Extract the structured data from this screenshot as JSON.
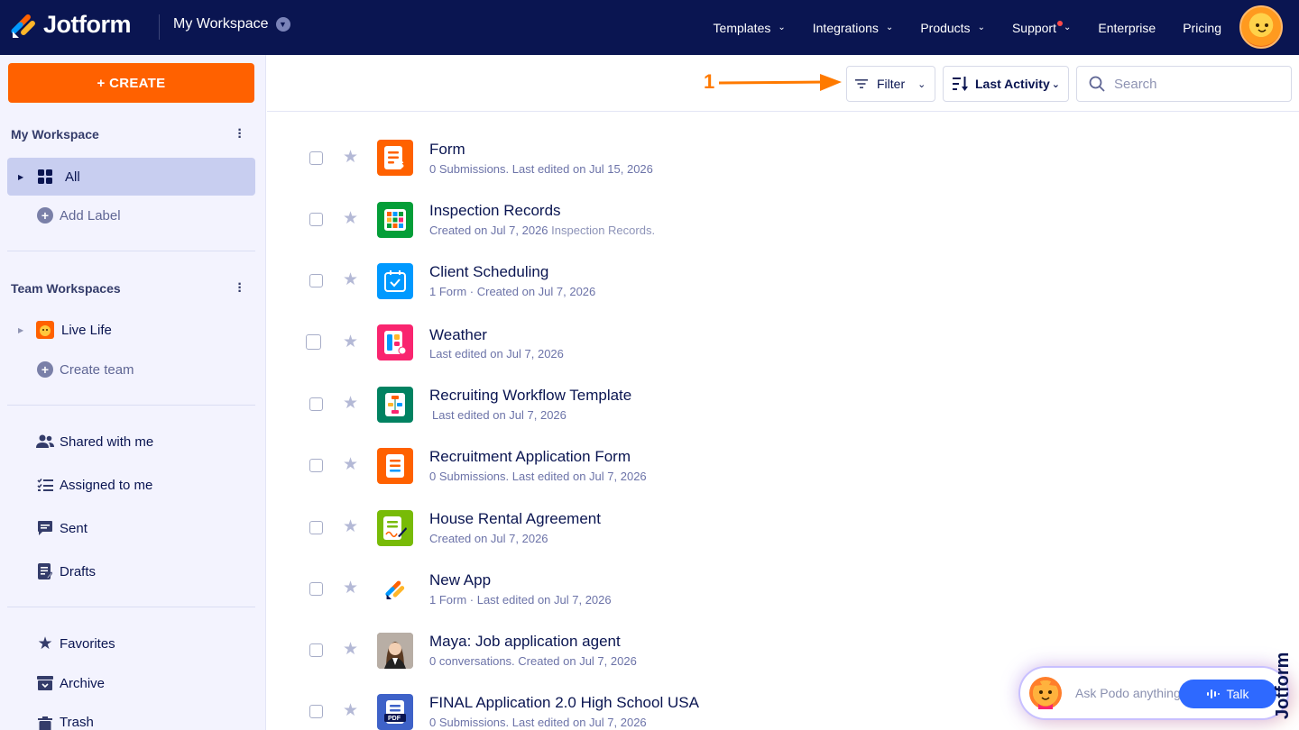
{
  "topbar": {
    "logo_text": "Jotform",
    "workspace_title": "My Workspace",
    "nav": [
      {
        "label": "Templates"
      },
      {
        "label": "Integrations"
      },
      {
        "label": "Products"
      },
      {
        "label": "Support"
      },
      {
        "label": "Enterprise"
      },
      {
        "label": "Pricing"
      }
    ]
  },
  "sidebar": {
    "create_label": "+ CREATE",
    "my_workspace_heading": "My Workspace",
    "all_label": "All",
    "add_label": "Add Label",
    "team_heading": "Team Workspaces",
    "team_live_life": "Live Life",
    "create_team": "Create team",
    "shared_with_me": "Shared with me",
    "assigned_to_me": "Assigned to me",
    "sent": "Sent",
    "drafts": "Drafts",
    "favorites": "Favorites",
    "archive": "Archive",
    "trash": "Trash"
  },
  "toolbar": {
    "annotation_number": "1",
    "filter_label": "Filter",
    "sort_label": "Last Activity",
    "search_placeholder": "Search"
  },
  "items": [
    {
      "title": "Form",
      "subtitle": "0 Submissions. Last edited on Jul 15, 2026",
      "subtitle_extra": "",
      "icon": "form-icon",
      "color": "#ff6100"
    },
    {
      "title": "Inspection Records",
      "subtitle": "Created on Jul 7, 2026",
      "subtitle_extra": "Inspection Records.",
      "icon": "table-icon",
      "color": "#049e38"
    },
    {
      "title": "Client Scheduling",
      "subtitle": "1 Form · Created on Jul 7, 2026",
      "subtitle_extra": "",
      "icon": "calendar-icon",
      "color": "#0099ff"
    },
    {
      "title": "Weather",
      "subtitle": "Last edited on Jul 7, 2026",
      "subtitle_extra": "",
      "icon": "app-icon",
      "color": "#f9256f"
    },
    {
      "title": "Recruiting Workflow Template",
      "subtitle": "Last edited on Jul 7, 2026",
      "subtitle_extra": "",
      "icon": "workflow-icon",
      "color": "#018261"
    },
    {
      "title": "Recruitment Application Form",
      "subtitle": "0 Submissions. Last edited on Jul 7, 2026",
      "subtitle_extra": "",
      "icon": "form-icon",
      "color": "#ff6100"
    },
    {
      "title": "House Rental Agreement",
      "subtitle": "Created on Jul 7, 2026",
      "subtitle_extra": "",
      "icon": "sign-document-icon",
      "color": "#78bb07"
    },
    {
      "title": "New App",
      "subtitle": "1 Form · Last edited on Jul 7, 2026",
      "subtitle_extra": "",
      "icon": "jotform-logo-icon",
      "color": "#ffffff"
    },
    {
      "title": "Maya: Job application agent",
      "subtitle": "0 conversations. Created on Jul 7, 2026",
      "subtitle_extra": "",
      "icon": "agent-avatar-icon",
      "color": "#9a8f87"
    },
    {
      "title": "FINAL Application 2.0 High School USA",
      "subtitle": "0 Submissions. Last edited on Jul 7, 2026",
      "subtitle_extra": "",
      "icon": "pdf-icon",
      "color": "#3e62c8"
    }
  ],
  "podo": {
    "prompt": "Ask Podo anything",
    "talk_label": "Talk"
  },
  "colors": {
    "navy": "#0a1551",
    "orange": "#ff6100",
    "sidebar_bg": "#f3f3fe",
    "active_item": "#c8cef0"
  }
}
